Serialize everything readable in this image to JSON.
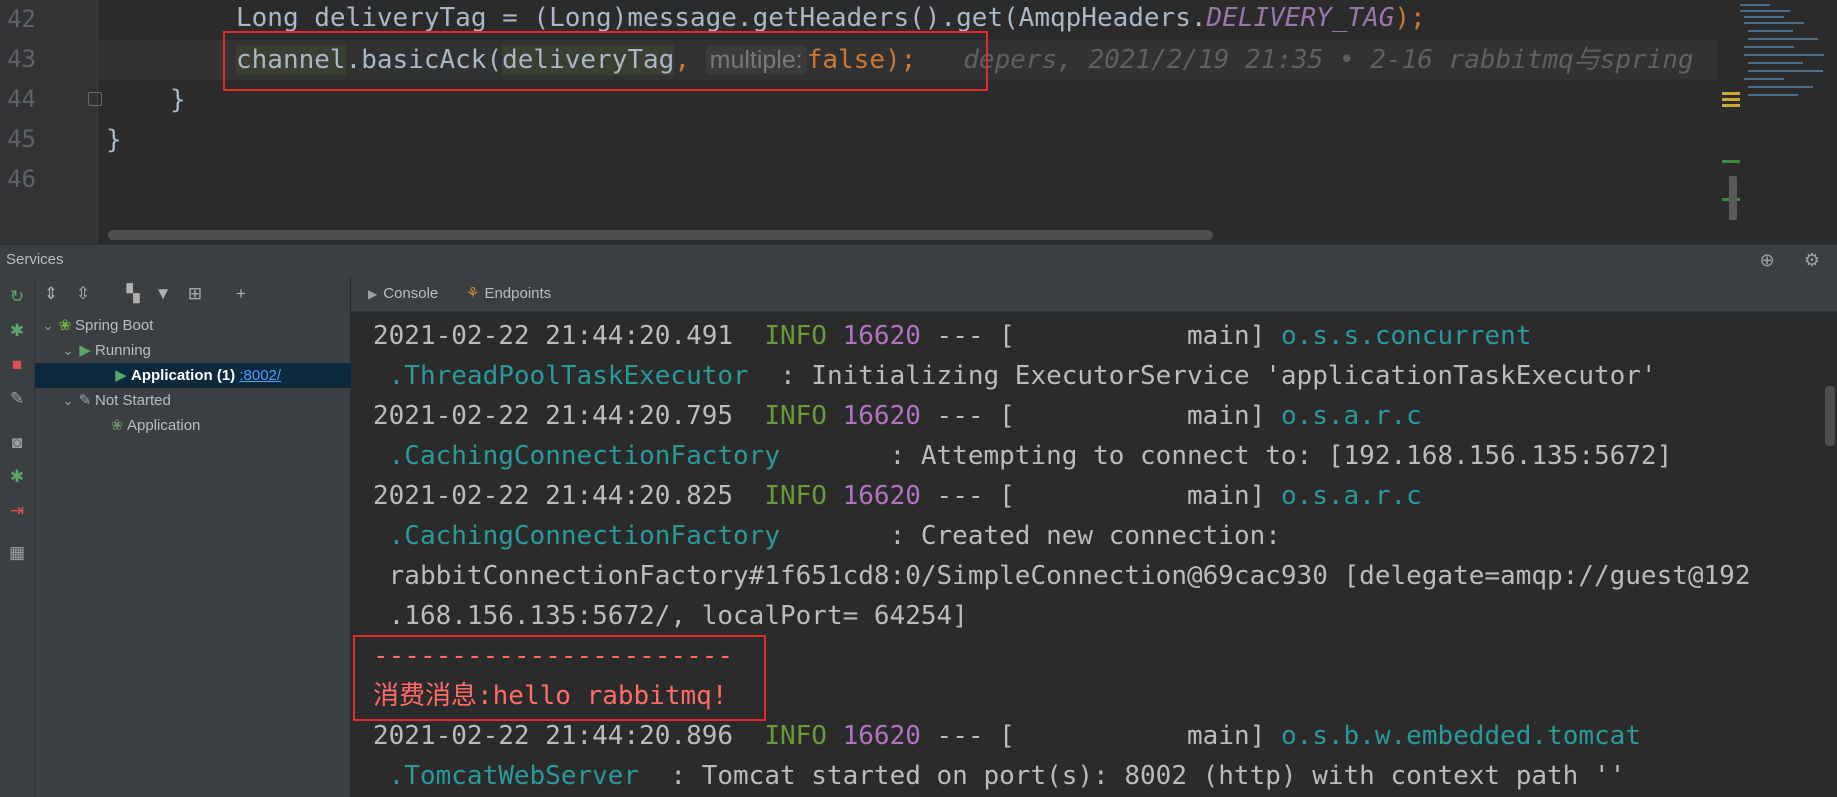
{
  "editor": {
    "line_numbers": [
      "42",
      "43",
      "44",
      "45",
      "46"
    ],
    "line42": {
      "type": "Long ",
      "var": "deliveryTag",
      "mid": " = (Long)message.getHeaders().get(AmqpHeaders.",
      "field": "DELIVERY_TAG",
      "end": ");"
    },
    "line43": {
      "obj": "channel",
      "call": ".basicAck(",
      "arg": "deliveryTag",
      "comma": ",",
      "hint": "multiple:",
      "value": "false",
      "end": ");",
      "blame": "depers, 2021/2/19 21:35 • 2-16 rabbitmq与spring"
    },
    "line44": "}",
    "line45": "}"
  },
  "services": {
    "title": "Services",
    "tree": {
      "spring_boot": "Spring Boot",
      "running": "Running",
      "app_running": "Application (1)",
      "app_port": ":8002/",
      "not_started": "Not Started",
      "app_idle": "Application"
    },
    "tabs": {
      "console": "Console",
      "endpoints": "Endpoints"
    }
  },
  "console": {
    "lines": [
      {
        "ts": "2021-02-22 21:44:20.491",
        "level": "INFO",
        "pid": "16620",
        "sep": " --- [",
        "thread": "main] ",
        "logger": "o.s.s.concurrent"
      },
      {
        "logger2": ".ThreadPoolTaskExecutor",
        "msg": "  : Initializing ExecutorService 'applicationTaskExecutor'"
      },
      {
        "ts": "2021-02-22 21:44:20.795",
        "level": "INFO",
        "pid": "16620",
        "sep": " --- [",
        "thread": "main] ",
        "logger": "o.s.a.r.c"
      },
      {
        "logger2": ".CachingConnectionFactory",
        "msg": "       : Attempting to connect to: [192.168.156.135:5672]"
      },
      {
        "ts": "2021-02-22 21:44:20.825",
        "level": "INFO",
        "pid": "16620",
        "sep": " --- [",
        "thread": "main] ",
        "logger": "o.s.a.r.c"
      },
      {
        "logger2": ".CachingConnectionFactory",
        "msg": "       : Created new connection:"
      },
      {
        "msg": " rabbitConnectionFactory#1f651cd8:0/SimpleConnection@69cac930 [delegate=amqp://guest@192"
      },
      {
        "msg": " .168.156.135:5672/, localPort= 64254]"
      },
      {
        "err": "-----------------------"
      },
      {
        "err": "消费消息:hello rabbitmq!"
      },
      {
        "ts": "2021-02-22 21:44:20.896",
        "level": "INFO",
        "pid": "16620",
        "sep": " --- [",
        "thread": "main] ",
        "logger": "o.s.b.w.embedded.tomcat"
      },
      {
        "logger2": ".TomcatWebServer",
        "msg": "  : Tomcat started on port(s): 8002 (http) with context path ''"
      }
    ]
  },
  "colors": {
    "highlight_box": "#e02c2c",
    "info": "#6a9a3a",
    "pid": "#b472c5",
    "logger": "#299999",
    "error_text": "#ff6b68"
  }
}
